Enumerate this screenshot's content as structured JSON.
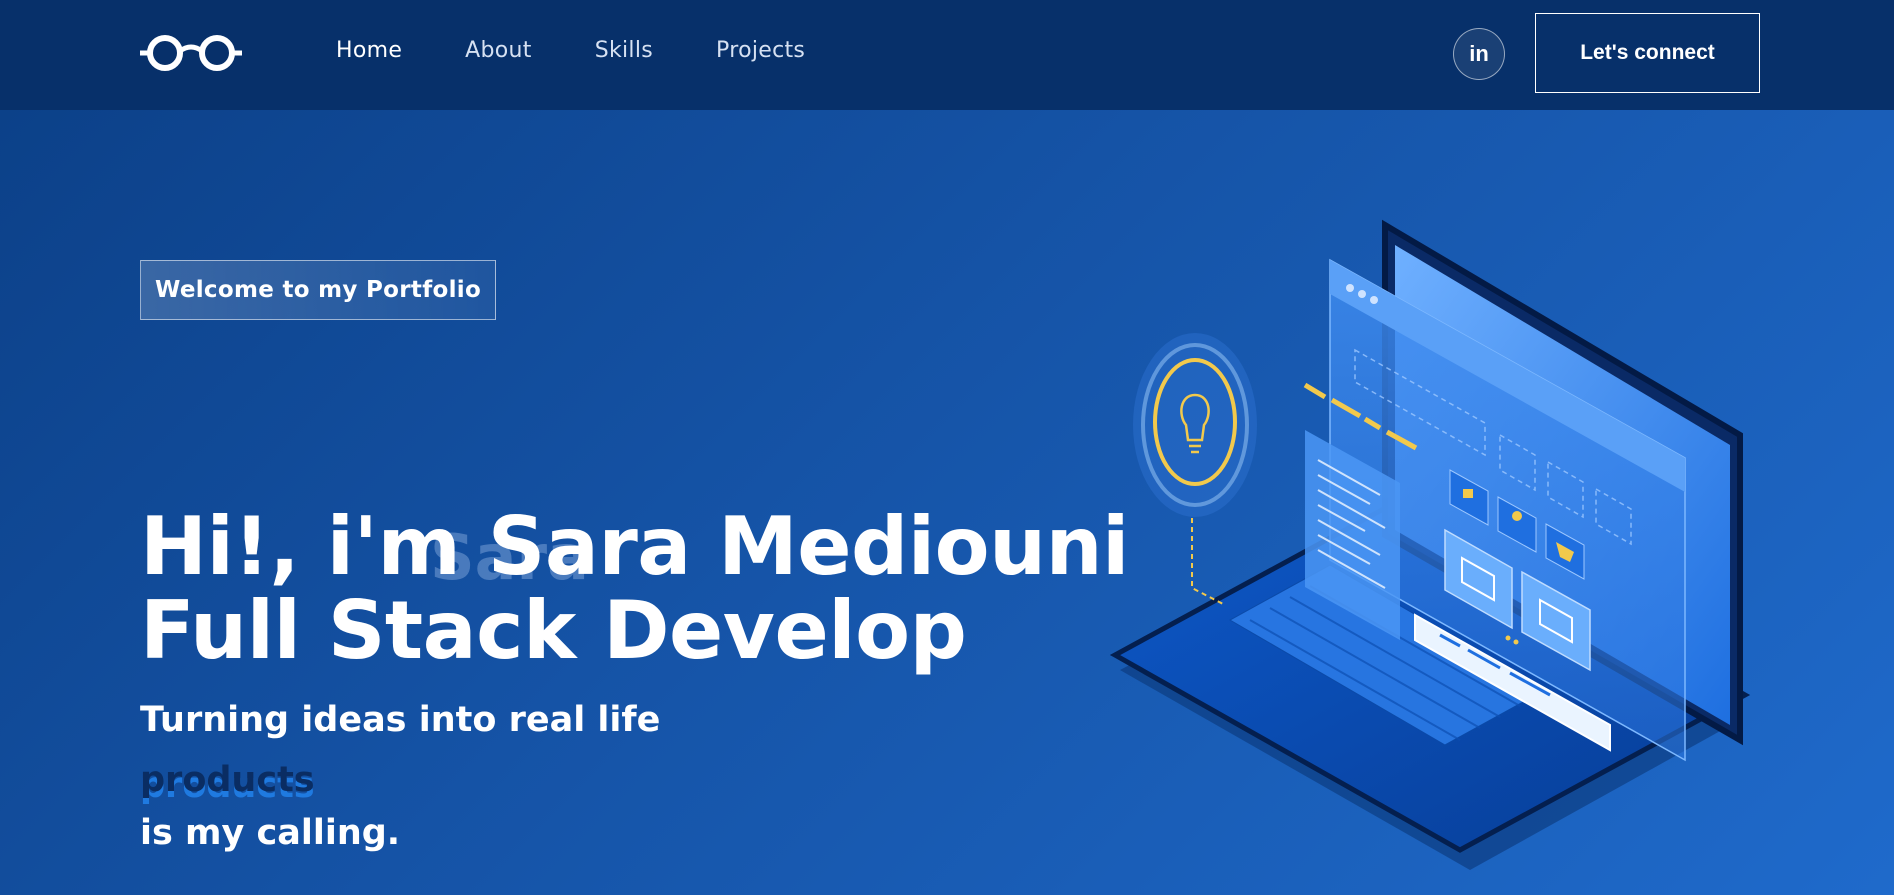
{
  "nav": {
    "links": [
      {
        "label": "Home",
        "active": true
      },
      {
        "label": "About"
      },
      {
        "label": "Skills"
      },
      {
        "label": "Projects"
      }
    ],
    "social_icon": "linkedin-icon",
    "social_label": "in",
    "connect_label": "Let's connect"
  },
  "hero": {
    "tagline": "Welcome to my Portfolio",
    "headline_line1": "Hi!, i'm Sara Mediouni",
    "headline_line2": "Full Stack Develop",
    "ghost_word": "Sara",
    "sub_line1": "Turning ideas into real life",
    "sub_line2": "products",
    "sub_line3": "is my calling."
  },
  "colors": {
    "nav_bg": "#07306a",
    "hero_start": "#0b3f86",
    "hero_end": "#1f6acb",
    "accent_yellow": "#f2c94c"
  },
  "illustration": {
    "icons": [
      "lightbulb-icon",
      "lock-icon",
      "user-icon",
      "cart-icon",
      "image-icon"
    ]
  }
}
